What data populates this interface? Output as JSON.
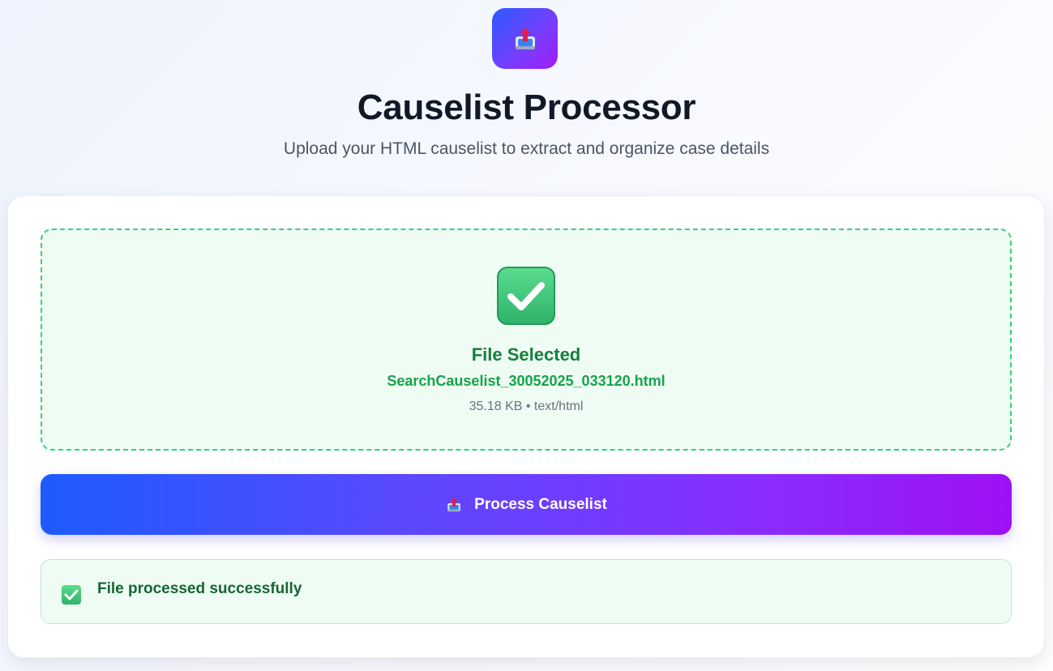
{
  "header": {
    "app_icon": "upload-tray-icon",
    "title": "Causelist Processor",
    "subtitle": "Upload your HTML causelist to extract and organize case details"
  },
  "upload": {
    "status_icon": "check-mark-icon",
    "status_label": "File Selected",
    "file_name": "SearchCauselist_30052025_033120.html",
    "file_meta": "35.18 KB • text/html"
  },
  "actions": {
    "process_icon": "upload-tray-icon",
    "process_label": "Process Causelist"
  },
  "alert": {
    "icon": "check-mark-icon",
    "message": "File processed successfully"
  },
  "colors": {
    "accent_start": "#1d5bff",
    "accent_end": "#9d10f5",
    "success": "#16a34a",
    "success_bg": "#effcf3"
  }
}
